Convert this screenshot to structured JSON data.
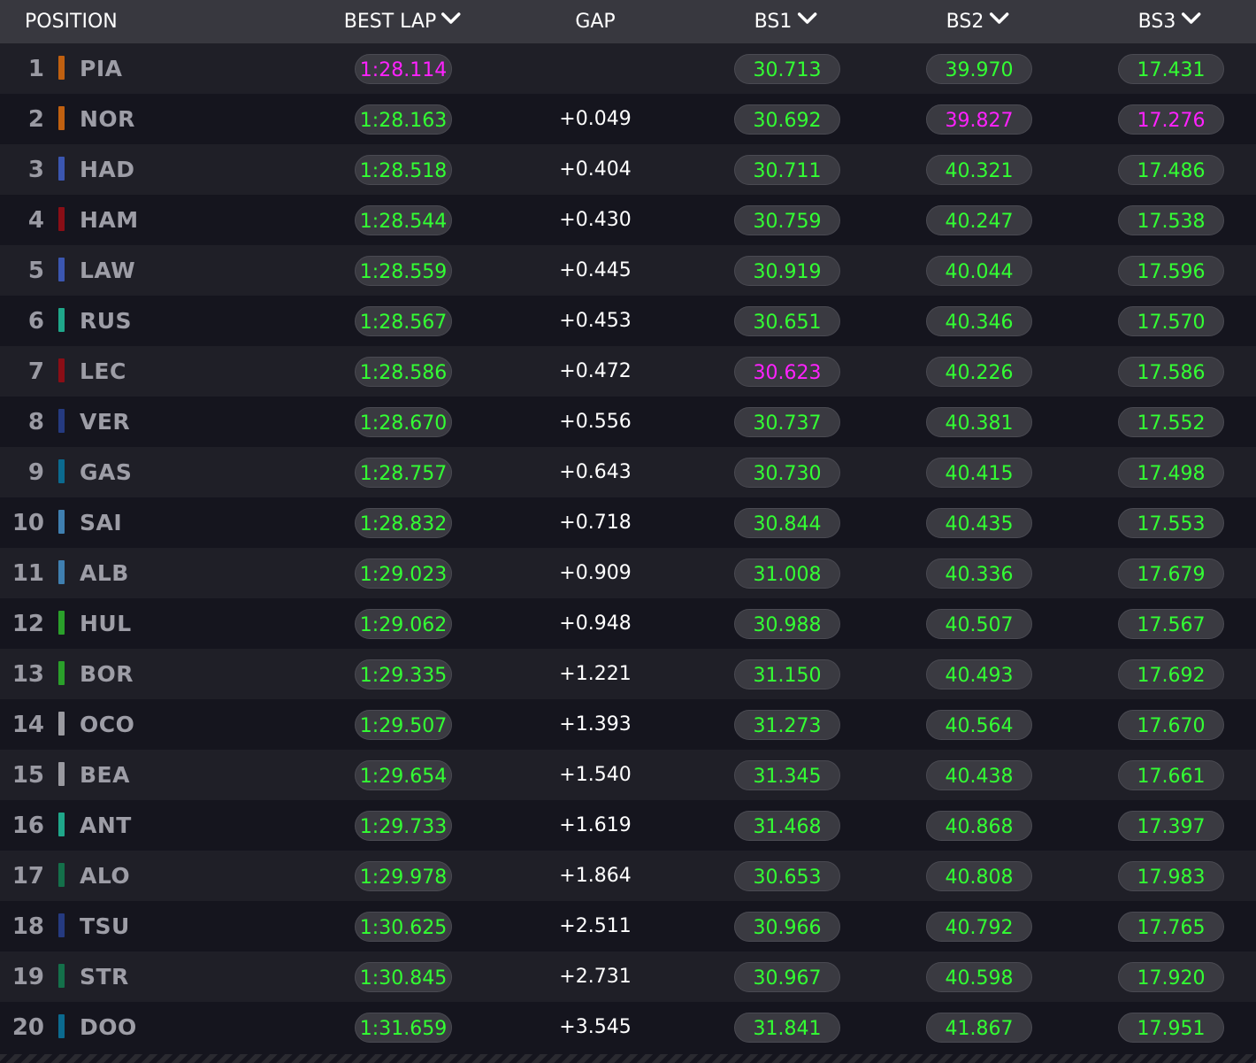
{
  "colors": {
    "background": "#15151e",
    "row_alt": "#1f1f27",
    "header": "#38383f",
    "time_green": "#33ff33",
    "time_purple": "#ff22ff",
    "gap_white": "#ffffff"
  },
  "header": {
    "position": "POSITION",
    "best_lap": "BEST LAP",
    "gap": "GAP",
    "bs1": "BS1",
    "bs2": "BS2",
    "bs3": "BS3",
    "sort_icon": "chevron-down-icon"
  },
  "rows": [
    {
      "pos": "1",
      "code": "PIA",
      "team_color": "#c06010",
      "best": "1:28.114",
      "gap": "",
      "bs1": "30.713",
      "bs2": "39.970",
      "bs3": "17.431",
      "best_status": "purple",
      "bs1_status": "green",
      "bs2_status": "green",
      "bs3_status": "green"
    },
    {
      "pos": "2",
      "code": "NOR",
      "team_color": "#c06010",
      "best": "1:28.163",
      "gap": "+0.049",
      "bs1": "30.692",
      "bs2": "39.827",
      "bs3": "17.276",
      "best_status": "green",
      "bs1_status": "green",
      "bs2_status": "purple",
      "bs3_status": "purple"
    },
    {
      "pos": "3",
      "code": "HAD",
      "team_color": "#3b56b0",
      "best": "1:28.518",
      "gap": "+0.404",
      "bs1": "30.711",
      "bs2": "40.321",
      "bs3": "17.486",
      "best_status": "green",
      "bs1_status": "green",
      "bs2_status": "green",
      "bs3_status": "green"
    },
    {
      "pos": "4",
      "code": "HAM",
      "team_color": "#8a0e16",
      "best": "1:28.544",
      "gap": "+0.430",
      "bs1": "30.759",
      "bs2": "40.247",
      "bs3": "17.538",
      "best_status": "green",
      "bs1_status": "green",
      "bs2_status": "green",
      "bs3_status": "green"
    },
    {
      "pos": "5",
      "code": "LAW",
      "team_color": "#3b56b0",
      "best": "1:28.559",
      "gap": "+0.445",
      "bs1": "30.919",
      "bs2": "40.044",
      "bs3": "17.596",
      "best_status": "green",
      "bs1_status": "green",
      "bs2_status": "green",
      "bs3_status": "green"
    },
    {
      "pos": "6",
      "code": "RUS",
      "team_color": "#1fa78a",
      "best": "1:28.567",
      "gap": "+0.453",
      "bs1": "30.651",
      "bs2": "40.346",
      "bs3": "17.570",
      "best_status": "green",
      "bs1_status": "green",
      "bs2_status": "green",
      "bs3_status": "green"
    },
    {
      "pos": "7",
      "code": "LEC",
      "team_color": "#8a0e16",
      "best": "1:28.586",
      "gap": "+0.472",
      "bs1": "30.623",
      "bs2": "40.226",
      "bs3": "17.586",
      "best_status": "green",
      "bs1_status": "purple",
      "bs2_status": "green",
      "bs3_status": "green"
    },
    {
      "pos": "8",
      "code": "VER",
      "team_color": "#253a80",
      "best": "1:28.670",
      "gap": "+0.556",
      "bs1": "30.737",
      "bs2": "40.381",
      "bs3": "17.552",
      "best_status": "green",
      "bs1_status": "green",
      "bs2_status": "green",
      "bs3_status": "green"
    },
    {
      "pos": "9",
      "code": "GAS",
      "team_color": "#0b6a8f",
      "best": "1:28.757",
      "gap": "+0.643",
      "bs1": "30.730",
      "bs2": "40.415",
      "bs3": "17.498",
      "best_status": "green",
      "bs1_status": "green",
      "bs2_status": "green",
      "bs3_status": "green"
    },
    {
      "pos": "10",
      "code": "SAI",
      "team_color": "#3f7fb0",
      "best": "1:28.832",
      "gap": "+0.718",
      "bs1": "30.844",
      "bs2": "40.435",
      "bs3": "17.553",
      "best_status": "green",
      "bs1_status": "green",
      "bs2_status": "green",
      "bs3_status": "green"
    },
    {
      "pos": "11",
      "code": "ALB",
      "team_color": "#3f7fb0",
      "best": "1:29.023",
      "gap": "+0.909",
      "bs1": "31.008",
      "bs2": "40.336",
      "bs3": "17.679",
      "best_status": "green",
      "bs1_status": "green",
      "bs2_status": "green",
      "bs3_status": "green"
    },
    {
      "pos": "12",
      "code": "HUL",
      "team_color": "#2aa02a",
      "best": "1:29.062",
      "gap": "+0.948",
      "bs1": "30.988",
      "bs2": "40.507",
      "bs3": "17.567",
      "best_status": "green",
      "bs1_status": "green",
      "bs2_status": "green",
      "bs3_status": "green"
    },
    {
      "pos": "13",
      "code": "BOR",
      "team_color": "#2aa02a",
      "best": "1:29.335",
      "gap": "+1.221",
      "bs1": "31.150",
      "bs2": "40.493",
      "bs3": "17.692",
      "best_status": "green",
      "bs1_status": "green",
      "bs2_status": "green",
      "bs3_status": "green"
    },
    {
      "pos": "14",
      "code": "OCO",
      "team_color": "#9a9aa0",
      "best": "1:29.507",
      "gap": "+1.393",
      "bs1": "31.273",
      "bs2": "40.564",
      "bs3": "17.670",
      "best_status": "green",
      "bs1_status": "green",
      "bs2_status": "green",
      "bs3_status": "green"
    },
    {
      "pos": "15",
      "code": "BEA",
      "team_color": "#9a9aa0",
      "best": "1:29.654",
      "gap": "+1.540",
      "bs1": "31.345",
      "bs2": "40.438",
      "bs3": "17.661",
      "best_status": "green",
      "bs1_status": "green",
      "bs2_status": "green",
      "bs3_status": "green"
    },
    {
      "pos": "16",
      "code": "ANT",
      "team_color": "#1fa78a",
      "best": "1:29.733",
      "gap": "+1.619",
      "bs1": "31.468",
      "bs2": "40.868",
      "bs3": "17.397",
      "best_status": "green",
      "bs1_status": "green",
      "bs2_status": "green",
      "bs3_status": "green"
    },
    {
      "pos": "17",
      "code": "ALO",
      "team_color": "#14704a",
      "best": "1:29.978",
      "gap": "+1.864",
      "bs1": "30.653",
      "bs2": "40.808",
      "bs3": "17.983",
      "best_status": "green",
      "bs1_status": "green",
      "bs2_status": "green",
      "bs3_status": "green"
    },
    {
      "pos": "18",
      "code": "TSU",
      "team_color": "#253a80",
      "best": "1:30.625",
      "gap": "+2.511",
      "bs1": "30.966",
      "bs2": "40.792",
      "bs3": "17.765",
      "best_status": "green",
      "bs1_status": "green",
      "bs2_status": "green",
      "bs3_status": "green"
    },
    {
      "pos": "19",
      "code": "STR",
      "team_color": "#14704a",
      "best": "1:30.845",
      "gap": "+2.731",
      "bs1": "30.967",
      "bs2": "40.598",
      "bs3": "17.920",
      "best_status": "green",
      "bs1_status": "green",
      "bs2_status": "green",
      "bs3_status": "green"
    },
    {
      "pos": "20",
      "code": "DOO",
      "team_color": "#0b6a8f",
      "best": "1:31.659",
      "gap": "+3.545",
      "bs1": "31.841",
      "bs2": "41.867",
      "bs3": "17.951",
      "best_status": "green",
      "bs1_status": "green",
      "bs2_status": "green",
      "bs3_status": "green"
    }
  ]
}
